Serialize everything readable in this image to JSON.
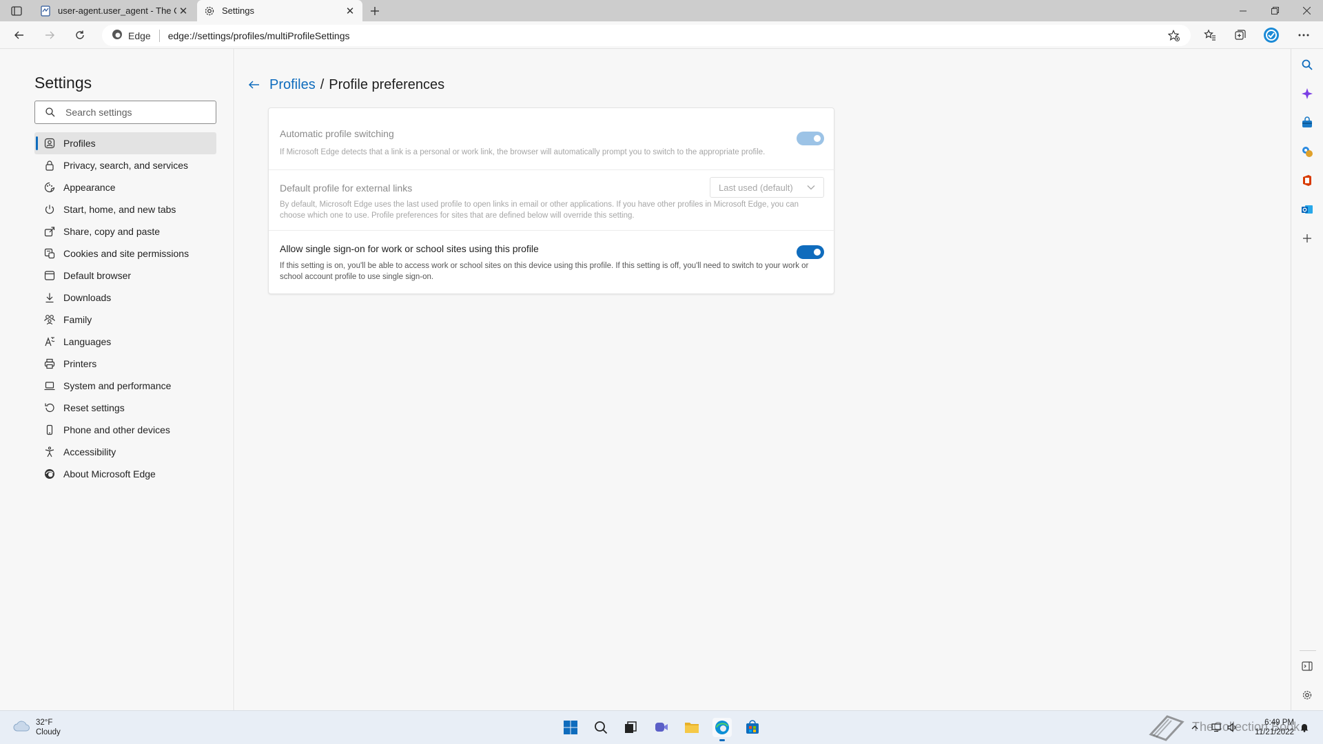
{
  "tabs": [
    {
      "title": "user-agent.user_agent - The Coll",
      "icon": "document-tab-icon",
      "active": false
    },
    {
      "title": "Settings",
      "icon": "gear-icon",
      "active": true
    }
  ],
  "toolbar": {
    "brand": "Edge",
    "url": "edge://settings/profiles/multiProfileSettings"
  },
  "nav": {
    "title": "Settings",
    "search_placeholder": "Search settings",
    "items": [
      {
        "label": "Profiles",
        "icon": "profile-icon",
        "active": true
      },
      {
        "label": "Privacy, search, and services",
        "icon": "lock-icon"
      },
      {
        "label": "Appearance",
        "icon": "appearance-icon"
      },
      {
        "label": "Start, home, and new tabs",
        "icon": "power-icon"
      },
      {
        "label": "Share, copy and paste",
        "icon": "share-icon"
      },
      {
        "label": "Cookies and site permissions",
        "icon": "cookie-icon"
      },
      {
        "label": "Default browser",
        "icon": "browser-icon"
      },
      {
        "label": "Downloads",
        "icon": "download-icon"
      },
      {
        "label": "Family",
        "icon": "family-icon"
      },
      {
        "label": "Languages",
        "icon": "language-icon"
      },
      {
        "label": "Printers",
        "icon": "printer-icon"
      },
      {
        "label": "System and performance",
        "icon": "laptop-icon"
      },
      {
        "label": "Reset settings",
        "icon": "reset-icon"
      },
      {
        "label": "Phone and other devices",
        "icon": "phone-icon"
      },
      {
        "label": "Accessibility",
        "icon": "accessibility-icon"
      },
      {
        "label": "About Microsoft Edge",
        "icon": "edge-logo-icon"
      }
    ]
  },
  "page": {
    "breadcrumb_parent": "Profiles",
    "breadcrumb_separator": "/",
    "breadcrumb_current": "Profile preferences",
    "rows": [
      {
        "title": "Automatic profile switching",
        "description": "If Microsoft Edge detects that a link is a personal or work link, the browser will automatically prompt you to switch to the appropriate profile.",
        "control": "toggle",
        "toggle_on": true,
        "enabled": false
      },
      {
        "title": "Default profile for external links",
        "description": "By default, Microsoft Edge uses the last used profile to open links in email or other applications. If you have other profiles in Microsoft Edge, you can choose which one to use. Profile preferences for sites that are defined below will override this setting.",
        "control": "dropdown",
        "dropdown_value": "Last used (default)",
        "enabled": false
      },
      {
        "title": "Allow single sign-on for work or school sites using this profile",
        "description": "If this setting is on, you'll be able to access work or school sites on this device using this profile. If this setting is off, you'll need to switch to your work or school account profile to use single sign-on.",
        "control": "toggle",
        "toggle_on": true,
        "enabled": true
      }
    ]
  },
  "taskbar": {
    "weather_temp": "32°F",
    "weather_cond": "Cloudy",
    "time": "6:49 PM",
    "date": "11/21/2022",
    "watermark": "TheCollection Book"
  },
  "colors": {
    "accent": "#0f6cbd",
    "toggle_disabled": "#9cc3e6"
  }
}
